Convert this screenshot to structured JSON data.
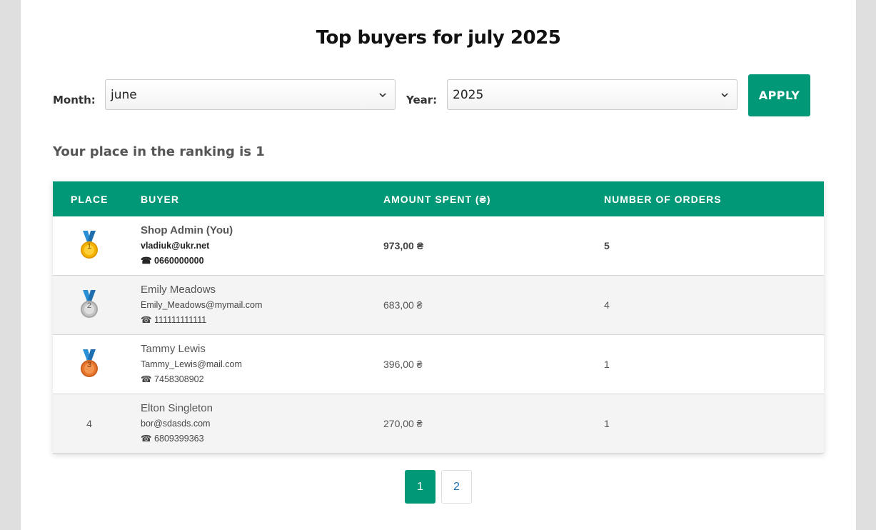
{
  "title": "Top buyers for july 2025",
  "filters": {
    "month_label": "Month:",
    "month_value": "june",
    "year_label": "Year:",
    "year_value": "2025",
    "apply_label": "APPLY"
  },
  "ranking_text": "Your place in the ranking is 1",
  "table": {
    "headers": [
      "PLACE",
      "BUYER",
      "AMOUNT SPENT (₴)",
      "NUMBER OF ORDERS"
    ],
    "rows": [
      {
        "place": "1",
        "medal": "gold-medal-icon",
        "name": "Shop Admin (You)",
        "email": "vladiuk@ukr.net",
        "phone": "☎ 0660000000",
        "amount": "973,00 ₴",
        "orders": "5"
      },
      {
        "place": "2",
        "medal": "silver-medal-icon",
        "name": "Emily Meadows",
        "email": "Emily_Meadows@mymail.com",
        "phone": "☎ 111111111111",
        "amount": "683,00 ₴",
        "orders": "4"
      },
      {
        "place": "3",
        "medal": "bronze-medal-icon",
        "name": "Tammy Lewis",
        "email": "Tammy_Lewis@mail.com",
        "phone": "☎ 7458308902",
        "amount": "396,00 ₴",
        "orders": "1"
      },
      {
        "place": "4",
        "medal": "",
        "name": "Elton Singleton",
        "email": "bor@sdasds.com",
        "phone": "☎ 6809399363",
        "amount": "270,00 ₴",
        "orders": "1"
      }
    ]
  },
  "pagination": {
    "pages": [
      "1",
      "2"
    ],
    "current": "1"
  },
  "colors": {
    "accent": "#009877",
    "gold": "#f5b400",
    "silver": "#b8b8b8",
    "bronze": "#e8772e",
    "ribbon": "#2b8fd6"
  }
}
